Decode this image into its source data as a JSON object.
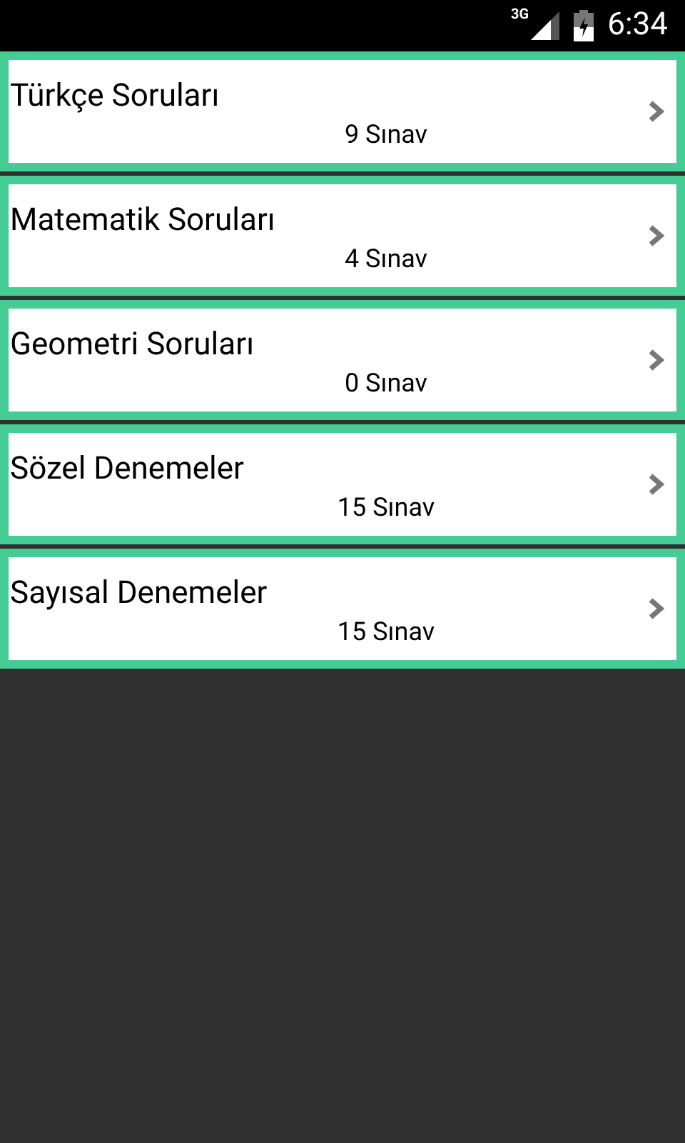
{
  "status_bar": {
    "network": "3G",
    "time": "6:34"
  },
  "categories": [
    {
      "title": "Türkçe Soruları",
      "count": "9 Sınav"
    },
    {
      "title": "Matematik Soruları",
      "count": "4 Sınav"
    },
    {
      "title": "Geometri Soruları",
      "count": "0 Sınav"
    },
    {
      "title": "Sözel Denemeler",
      "count": "15 Sınav"
    },
    {
      "title": "Sayısal Denemeler",
      "count": "15 Sınav"
    }
  ]
}
